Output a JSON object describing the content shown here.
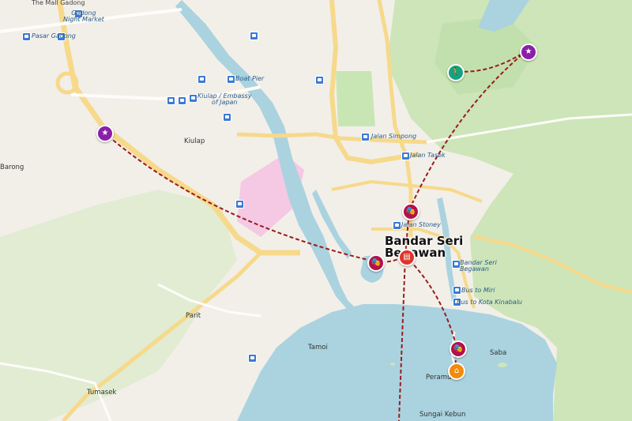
{
  "labels": {
    "city": "Bandar Seri Begawan",
    "city_line1": "Bandar Seri",
    "city_line2": "Begawan",
    "kiulap": "Kiulap",
    "barong": "Barong",
    "parit": "Parit",
    "tamoi": "Tamoi",
    "tumasek": "Tumasek",
    "saba": "Saba",
    "peramu": "Peramu",
    "sungai_kebun": "Sungai Kebun",
    "gadong_night_market": "Gadong Night Market",
    "gadong_line1": "Gadong",
    "gadong_line2": "Night Market",
    "pasar_gadong": "Pasar Gadong",
    "the_mall_gadong": "The Mall Gadong",
    "boat_pier": "Boat Pier",
    "kiulap_embassy": "Kiulap / Embassy of Japan",
    "kiulap_embassy_line1": "Kiulap / Embassy",
    "kiulap_embassy_line2": "of Japan",
    "jalan_simpong": "Jalan Simpong",
    "jalan_tasek": "Jalan Tasek",
    "jalan_stoney": "Jalan Stoney",
    "bsb_stop": "Bandar Seri Begawan",
    "bsb_stop_line1": "Bandar Seri",
    "bsb_stop_line2": "Begawan",
    "bus_to_miri": "Bus to Miri",
    "bus_to_kota_kinabalu": "Bus to Kota Kinabalu"
  },
  "markers": [
    {
      "name": "attraction-star-kiulap",
      "icon": "star-icon",
      "color": "#8b1fa9"
    },
    {
      "name": "attraction-star-northeast",
      "icon": "star-icon",
      "color": "#8b1fa9"
    },
    {
      "name": "hiking-trail",
      "icon": "hiker-icon",
      "color": "#16a37c"
    },
    {
      "name": "theater-north",
      "icon": "theater-masks-icon",
      "color": "#b3114a"
    },
    {
      "name": "theater-west",
      "icon": "theater-masks-icon",
      "color": "#b3114a"
    },
    {
      "name": "theater-south",
      "icon": "theater-masks-icon",
      "color": "#b3114a"
    },
    {
      "name": "city-center-building",
      "icon": "building-icon",
      "color": "#e0342a"
    },
    {
      "name": "home-peramu",
      "icon": "home-icon",
      "color": "#f28a0b"
    }
  ],
  "colors": {
    "route": "#9c1b1b",
    "water": "#aad3df",
    "land": "#f2efe9",
    "park": "#c8e6b4",
    "road_major": "#f7d98b",
    "bus_stop": "#3a7bd5"
  }
}
